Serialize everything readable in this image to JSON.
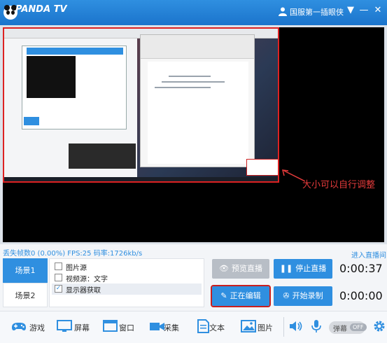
{
  "titlebar": {
    "logo_text": "PANDA TV",
    "username": "国服第一插眼侠",
    "buttons": [
      "user-menu",
      "minimize",
      "close"
    ]
  },
  "preview": {
    "annotation": "大小可以自行调整"
  },
  "stats": {
    "text": "丢失帧数0 (0.00%) FPS:25 码率:1726kb/s",
    "live_link": "进入直播间"
  },
  "scenes": [
    {
      "label": "场景1",
      "active": true
    },
    {
      "label": "场景2",
      "active": false
    }
  ],
  "sources": [
    {
      "label": "图片源",
      "checked": false
    },
    {
      "label": "视频源：文字",
      "checked": false
    },
    {
      "label": "显示器获取",
      "checked": true
    }
  ],
  "controls": {
    "preview_live": "预览直播",
    "stop_live": "停止直播",
    "editing": "正在编辑",
    "start_record": "开始录制",
    "live_time": "0:00:37",
    "record_time": "0:00:00"
  },
  "toolbar": {
    "game": "游戏",
    "screen": "屏幕",
    "window": "窗口",
    "capture": "采集",
    "text": "文本",
    "image": "图片",
    "danmu": "弹幕",
    "toggle_state": "OFF"
  },
  "colors": {
    "brand": "#2f8fe0",
    "highlight": "#c81f1f",
    "annotation": "#e53b3b"
  }
}
